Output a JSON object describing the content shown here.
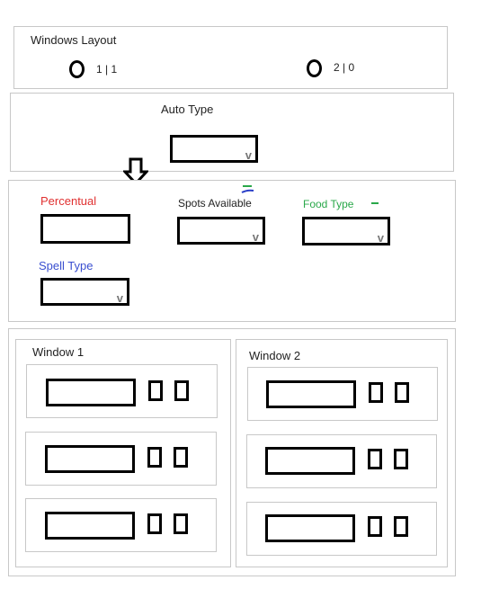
{
  "windows_layout": {
    "title": "Windows Layout",
    "options": [
      {
        "label": "1 | 1"
      },
      {
        "label": "2 | 0"
      }
    ]
  },
  "auto_type": {
    "title": "Auto Type",
    "dropdown_chevron": "v"
  },
  "arrow_icon": "down-arrow-icon",
  "fields": {
    "percentual": {
      "label": "Percentual",
      "color": "#e03030"
    },
    "spots_available": {
      "label": "Spots Available",
      "color": "#222222",
      "chevron": "v"
    },
    "food_type": {
      "label": "Food Type",
      "color": "#2aa84a",
      "chevron": "v"
    },
    "spell_type": {
      "label": "Spell Type",
      "color": "#3a4fd0",
      "chevron": "v"
    }
  },
  "windows": [
    {
      "title": "Window 1",
      "rows": 3
    },
    {
      "title": "Window 2",
      "rows": 3
    }
  ]
}
